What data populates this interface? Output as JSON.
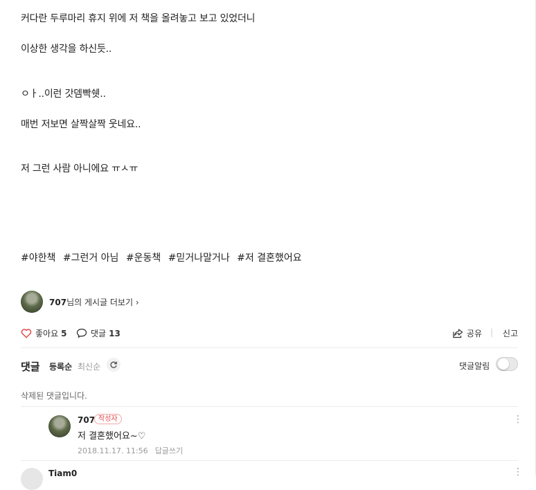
{
  "post": {
    "lines": [
      "커다란 두루마리 휴지 위에 저 책을 올려놓고 보고 있었더니",
      "이상한 생각을 하신듯..",
      "ㅇㅏ..이런 갓뎀빡쉣..",
      "매번 저보면 살짝살짝 웃네요..",
      "저 그런 사람 아니에요 ㅠㅅㅠ"
    ],
    "tags": [
      "#야한책",
      "#그런거 아님",
      "#운동책",
      "#믿거나말거나",
      "#저 결혼했어요"
    ]
  },
  "author_link": {
    "name": "707",
    "suffix": "님의 게시글 더보기 ›"
  },
  "reactions": {
    "like_label": "좋아요",
    "like_count": "5",
    "comment_label": "댓글",
    "comment_count": "13",
    "share_label": "공유",
    "report_label": "신고"
  },
  "comments": {
    "title": "댓글",
    "sort_registered": "등록순",
    "sort_latest": "최신순",
    "alarm_label": "댓글알림",
    "alarm_on": false,
    "deleted_text": "삭제된 댓글입니다.",
    "reply": {
      "author": "707",
      "badge": "작성자",
      "text": "저 결혼했어요~♡",
      "date": "2018.11.17. 11:56",
      "reply_label": "답글쓰기"
    },
    "next_author": "Tiam0"
  },
  "colors": {
    "heart": "#e34a4a",
    "badge": "#e34a4a",
    "divider": "#ececec"
  },
  "icons": [
    "heart-icon",
    "comment-bubble-icon",
    "share-icon",
    "refresh-icon",
    "more-vertical-icon"
  ]
}
